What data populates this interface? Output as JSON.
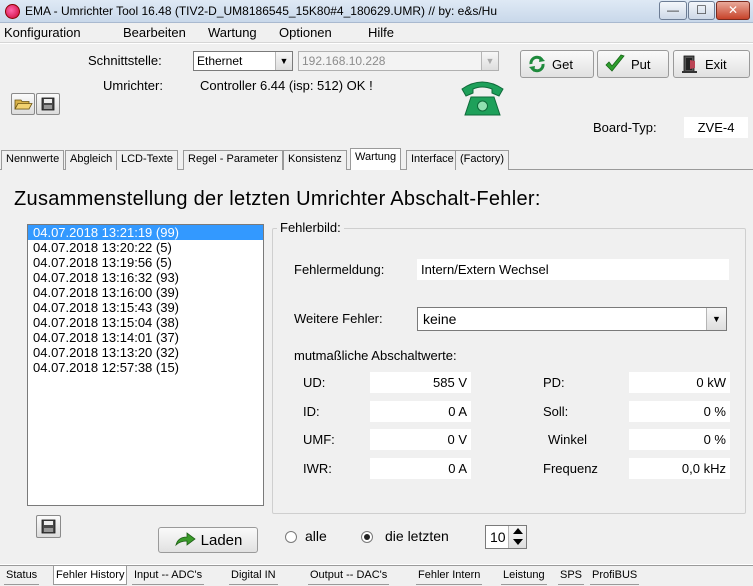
{
  "window": {
    "title": "EMA - Umrichter Tool 16.48 (TIV2-D_UM8186545_15K80#4_180629.UMR)  // by: e&s/Hu",
    "min_label": "—",
    "max_label": "☐",
    "close_label": "✕"
  },
  "menubar": [
    "Konfiguration",
    "Bearbeiten",
    "Wartung",
    "Optionen",
    "Hilfe"
  ],
  "toolbar": {
    "schnittstelle_label": "Schnittstelle:",
    "schnittstelle_value": "Ethernet",
    "ip_value": "192.168.10.228",
    "umrichter_label": "Umrichter:",
    "umrichter_value": "Controller 6.44 (isp: 512) OK !",
    "get_label": "Get",
    "put_label": "Put",
    "exit_label": "Exit",
    "board_typ_label": "Board-Typ:",
    "board_typ_value": "ZVE-4"
  },
  "tabs": [
    {
      "label": "Nennwerte",
      "active": false
    },
    {
      "label": "Abgleich",
      "active": false
    },
    {
      "label": "LCD-Texte",
      "active": false
    },
    {
      "label": "Regel - Parameter",
      "active": false
    },
    {
      "label": "Konsistenz",
      "active": false
    },
    {
      "label": "Wartung",
      "active": true
    },
    {
      "label": "Interface",
      "active": false
    },
    {
      "label": "(Factory)",
      "active": false
    }
  ],
  "main": {
    "heading": "Zusammenstellung der letzten Umrichter Abschalt-Fehler:",
    "errors": [
      "04.07.2018 13:21:19  (99)",
      "04.07.2018 13:20:22  (5)",
      "04.07.2018 13:19:56  (5)",
      "04.07.2018 13:16:32  (93)",
      "04.07.2018 13:16:00  (39)",
      "04.07.2018 13:15:43  (39)",
      "04.07.2018 13:15:04  (38)",
      "04.07.2018 13:14:01  (37)",
      "04.07.2018 13:13:20  (32)",
      "04.07.2018 12:57:38  (15)"
    ],
    "selected_index": 0,
    "fehlerbild": {
      "legend": "Fehlerbild:",
      "fehlermeldung_label": "Fehlermeldung:",
      "fehlermeldung_value": "Intern/Extern Wechsel",
      "weitere_label": "Weitere Fehler:",
      "weitere_value": "keine",
      "mutmasslich_label": "mutmaßliche Abschaltwerte:",
      "ud_label": "UD:",
      "ud_value": "585 V",
      "id_label": "ID:",
      "id_value": "0 A",
      "umf_label": "UMF:",
      "umf_value": "0 V",
      "iwr_label": "IWR:",
      "iwr_value": "0 A",
      "pd_label": "PD:",
      "pd_value": "0 kW",
      "soll_label": "Soll:",
      "soll_value": "0 %",
      "winkel_label": "Winkel",
      "winkel_value": "0 %",
      "frequenz_label": "Frequenz",
      "frequenz_value": "0,0 kHz"
    },
    "laden_label": "Laden",
    "radio_alle_label": "alle",
    "radio_letzten_label": "die letzten",
    "count_value": "10"
  },
  "status_tabs": [
    {
      "label": "Status",
      "active": false
    },
    {
      "label": "Fehler History",
      "active": true
    },
    {
      "label": "Input -- ADC's",
      "active": false
    },
    {
      "label": "Digital  IN",
      "active": false
    },
    {
      "label": "Output -- DAC's",
      "active": false
    },
    {
      "label": "Fehler Intern",
      "active": false
    },
    {
      "label": "Leistung",
      "active": false
    },
    {
      "label": "SPS",
      "active": false
    },
    {
      "label": "ProfiBUS",
      "active": false
    }
  ],
  "colors": {
    "selection": "#3399ff",
    "get_icon": "#1e8a3c",
    "put_check": "#2e9e2e",
    "phone_icon": "#1ea05a",
    "laden_arrow": "#3a9a2a"
  },
  "icons": [
    "app-icon",
    "open-folder-icon",
    "save-disk-icon",
    "refresh-icon",
    "checkmark-icon",
    "exit-door-icon",
    "telephone-icon",
    "green-arrow-icon",
    "spinner-up-icon",
    "spinner-down-icon"
  ]
}
